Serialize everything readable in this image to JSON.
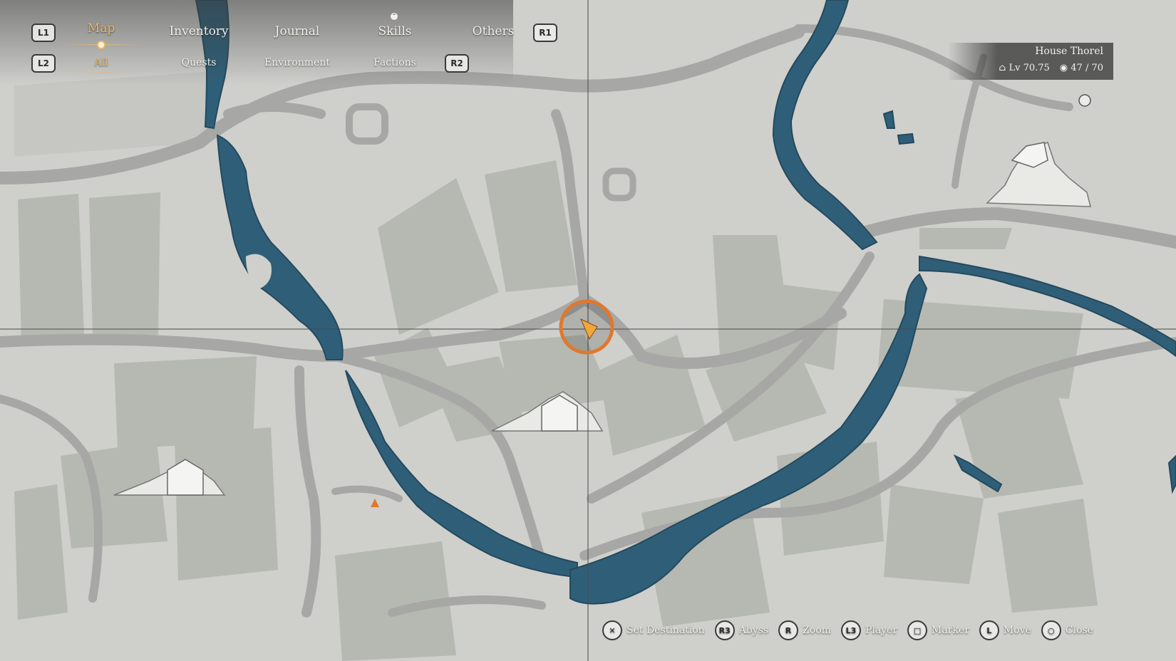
{
  "nav": {
    "tabs": [
      {
        "label": "Map",
        "active": true
      },
      {
        "label": "Inventory",
        "active": false
      },
      {
        "label": "Journal",
        "active": false
      },
      {
        "label": "Skills",
        "active": false
      },
      {
        "label": "Others",
        "active": false
      }
    ],
    "subtabs": [
      {
        "label": "All",
        "active": true
      },
      {
        "label": "Quests",
        "active": false
      },
      {
        "label": "Environment",
        "active": false
      },
      {
        "label": "Factions",
        "active": false
      }
    ],
    "keys": {
      "l1": "L1",
      "r1": "R1",
      "l2": "L2",
      "r2": "R2"
    }
  },
  "region": {
    "name": "House Thorel",
    "level_label": "Lv",
    "level": "70.75",
    "progress": "47 / 70"
  },
  "hints": [
    {
      "button": "✕",
      "label": "Set Destination",
      "icon": "cross-button-icon"
    },
    {
      "button": "R3",
      "label": "Abyss",
      "icon": "r3-button-icon"
    },
    {
      "button": "R",
      "label": "Zoom",
      "icon": "right-stick-icon"
    },
    {
      "button": "L3",
      "label": "Player",
      "icon": "l3-button-icon"
    },
    {
      "button": "□",
      "label": "Marker",
      "icon": "square-button-icon"
    },
    {
      "button": "L",
      "label": "Move",
      "icon": "left-stick-icon"
    },
    {
      "button": "○",
      "label": "Close",
      "icon": "circle-button-icon"
    }
  ],
  "colors": {
    "land": "#cfcfcc",
    "road": "#a7a8a5",
    "field": "#b4b8b0",
    "river": "#2f5f78",
    "accent": "#e8b86a",
    "player_marker": "#e0782e"
  }
}
